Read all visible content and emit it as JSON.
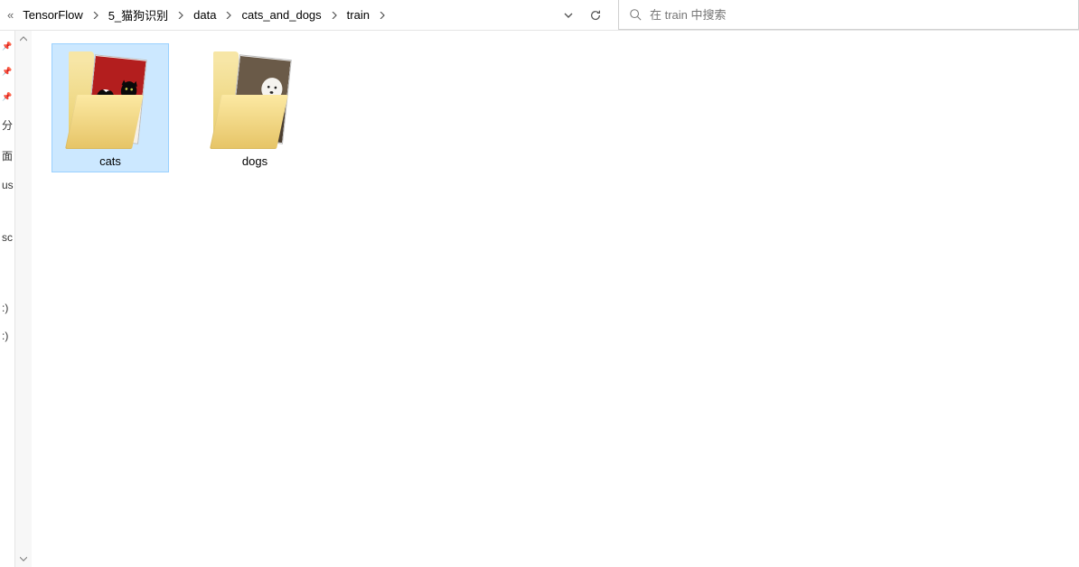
{
  "breadcrumb": {
    "overflow_glyph": "«",
    "items": [
      "TensorFlow",
      "5_猫狗识别",
      "data",
      "cats_and_dogs",
      "train"
    ]
  },
  "search": {
    "placeholder": "在 train 中搜索"
  },
  "sidebar": {
    "items": [
      "分",
      "面",
      "us",
      "sc",
      ":)",
      ":)"
    ]
  },
  "folders": [
    {
      "name": "cats",
      "selected": true,
      "thumb": "cats"
    },
    {
      "name": "dogs",
      "selected": false,
      "thumb": "dogs"
    }
  ]
}
